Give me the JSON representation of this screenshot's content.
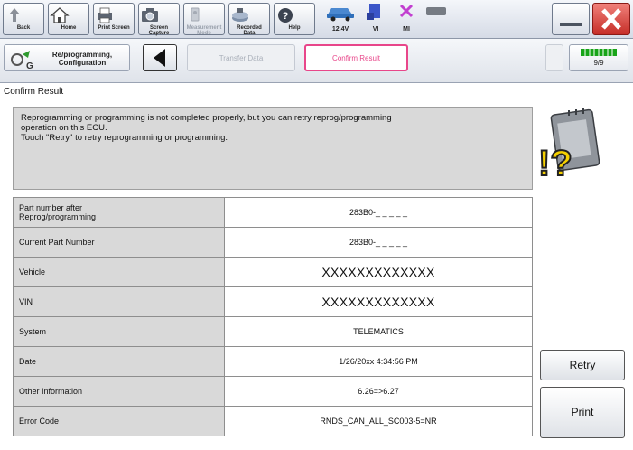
{
  "toolbar": {
    "back_label": "Back",
    "home_label": "Home",
    "print_screen_label": "Print Screen",
    "screen_capture_label": "Screen\nCapture",
    "measurement_mode_label": "Measurement\nMode",
    "recorded_data_label": "Recorded\nData",
    "help_label": "Help",
    "battery_voltage": "12.4V",
    "vi_label": "VI",
    "mi_label": "MI"
  },
  "nav": {
    "reprogramming_label": "Re/programming,\nConfiguration",
    "previous_step_label": "Transfer Data",
    "current_step_label": "Confirm Result",
    "step_counter": "9/9"
  },
  "page": {
    "title": "Confirm Result"
  },
  "message": {
    "line1": "Reprogramming or programming is not completed properly, but you can retry reprog/programming",
    "line2": "operation on this ECU.",
    "line3": "Touch \"Retry\" to retry reprogramming or programming."
  },
  "details": [
    {
      "label": "Part number after\nReprog/programming",
      "value": "283B0-_ _ _ _ _",
      "big": false
    },
    {
      "label": "Current Part Number",
      "value": "283B0-_ _ _ _ _",
      "big": false
    },
    {
      "label": "Vehicle",
      "value": "XXXXXXXXXXXXX",
      "big": true
    },
    {
      "label": "VIN",
      "value": "XXXXXXXXXXXXX",
      "big": true
    },
    {
      "label": "System",
      "value": "TELEMATICS",
      "big": false
    },
    {
      "label": "Date",
      "value": "1/26/20xx 4:34:56 PM",
      "big": false
    },
    {
      "label": "Other Information",
      "value": "6.26=>6.27",
      "big": false
    },
    {
      "label": "Error Code",
      "value": "RNDS_CAN_ALL_SC003-5=NR",
      "big": false
    }
  ],
  "actions": {
    "retry_label": "Retry",
    "print_label": "Print"
  },
  "colors": {
    "accent_pink": "#e8468a",
    "panel_gray": "#d9d9d9",
    "warning_yellow": "#f5d000",
    "close_red": "#d9403a",
    "progress_green": "#18a418"
  }
}
